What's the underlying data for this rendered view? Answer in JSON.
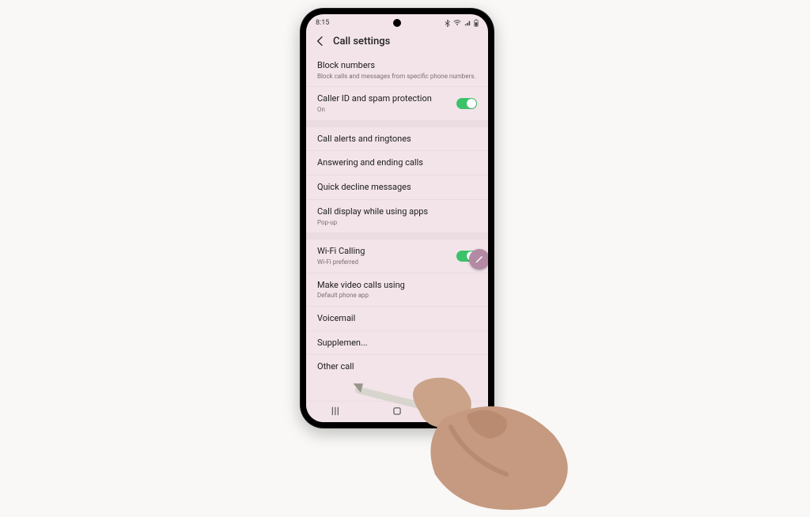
{
  "status": {
    "time": "8:15"
  },
  "header": {
    "title": "Call settings"
  },
  "items": {
    "block_numbers": {
      "label": "Block numbers",
      "sub": "Block calls and messages from specific phone numbers."
    },
    "caller_id": {
      "label": "Caller ID and spam protection",
      "sub": "On"
    },
    "call_alerts": {
      "label": "Call alerts and ringtones"
    },
    "answering": {
      "label": "Answering and ending calls"
    },
    "quick_decline": {
      "label": "Quick decline messages"
    },
    "call_display": {
      "label": "Call display while using apps",
      "sub": "Pop-up"
    },
    "wifi_calling": {
      "label": "Wi-Fi Calling",
      "sub": "Wi-Fi preferred"
    },
    "video_calls": {
      "label": "Make video calls using",
      "sub": "Default phone app"
    },
    "voicemail": {
      "label": "Voicemail"
    },
    "supplementary": {
      "label": "Supplemen..."
    },
    "other": {
      "label": "Other call"
    }
  }
}
